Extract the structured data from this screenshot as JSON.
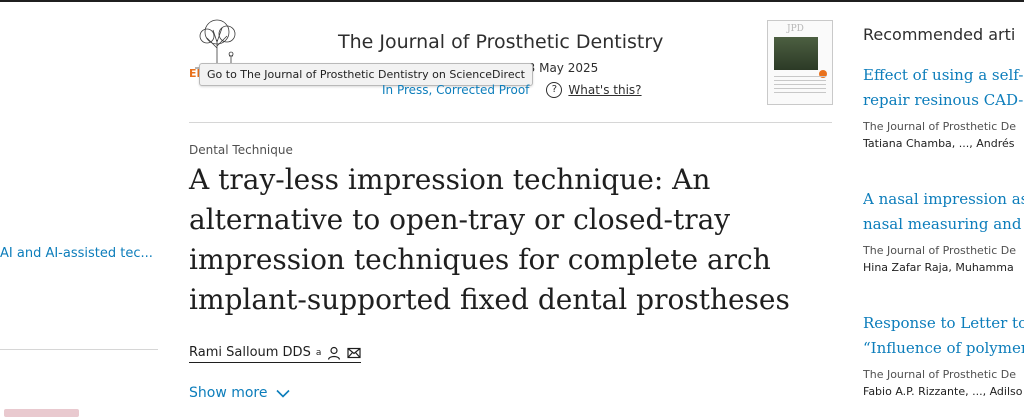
{
  "sidebar": {
    "toc_link": "AI and AI-assisted tec..."
  },
  "header": {
    "journal_title": "The Journal of Prosthetic Dentistry",
    "logo_text": "EL",
    "tooltip": "Go to The Journal of Prosthetic Dentistry on ScienceDirect",
    "available_date": "13 May 2025",
    "status": "In Press, Corrected Proof",
    "whats_this": "What's this?",
    "cover_title": "JPD"
  },
  "article": {
    "section": "Dental Technique",
    "title": "A tray-less impression technique: An alternative to open-tray or closed-tray impression techniques for complete arch implant-supported fixed dental prostheses",
    "author": "Rami Salloum DDS",
    "author_sup": "a",
    "show_more": "Show more"
  },
  "recommended": {
    "heading": "Recommended arti",
    "items": [
      {
        "title_line1": "Effect of using a self-et",
        "title_line2": "repair resinous CAD-C.",
        "journal": "The Journal of Prosthetic De",
        "authors": "Tatiana Chamba, ..., Andrés"
      },
      {
        "title_line1": "A nasal impression ass",
        "title_line2": "nasal measuring and in",
        "journal": "The Journal of Prosthetic De",
        "authors": "Hina Zafar Raja, Muhamma"
      },
      {
        "title_line1": "Response to Letter to t",
        "title_line2": "“Influence of polymeri",
        "journal": "The Journal of Prosthetic De",
        "authors": "Fabio A.P. Rizzante, ..., Adilso"
      }
    ]
  },
  "colors": {
    "link": "#0c7dbb",
    "brand_orange": "#e9711c",
    "text": "#1f1f1f"
  }
}
